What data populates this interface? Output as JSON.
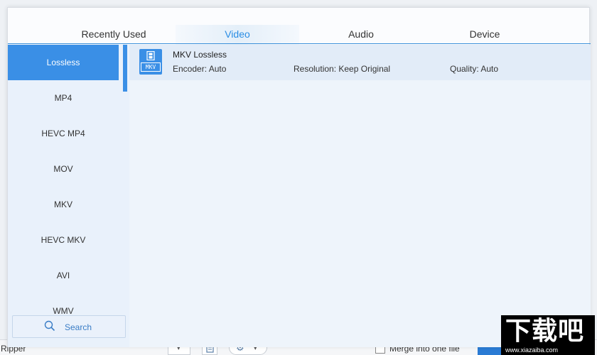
{
  "background_app": {
    "label_left": "Ripper",
    "merge_label": "Merge into one file"
  },
  "tabs": [
    {
      "label": "Recently Used",
      "active": false
    },
    {
      "label": "Video",
      "active": true
    },
    {
      "label": "Audio",
      "active": false
    },
    {
      "label": "Device",
      "active": false
    }
  ],
  "categories": [
    {
      "label": "Lossless",
      "selected": true
    },
    {
      "label": "MP4"
    },
    {
      "label": "HEVC MP4"
    },
    {
      "label": "MOV"
    },
    {
      "label": "MKV"
    },
    {
      "label": "HEVC MKV"
    },
    {
      "label": "AVI"
    },
    {
      "label": "WMV"
    }
  ],
  "search": {
    "label": "Search",
    "icon": "search-icon"
  },
  "presets": [
    {
      "name": "MKV Lossless",
      "format_badge": "MKV",
      "encoder": "Encoder: Auto",
      "resolution": "Resolution: Keep Original",
      "quality": "Quality: Auto"
    }
  ],
  "watermark": {
    "logo": "下载吧",
    "url": "www.xiazaiba.com"
  },
  "colors": {
    "accent": "#3a8fe6",
    "active_tab_text": "#2a8de4",
    "sidebar_bg": "#e9f1fb",
    "content_bg": "#eef4fb"
  }
}
